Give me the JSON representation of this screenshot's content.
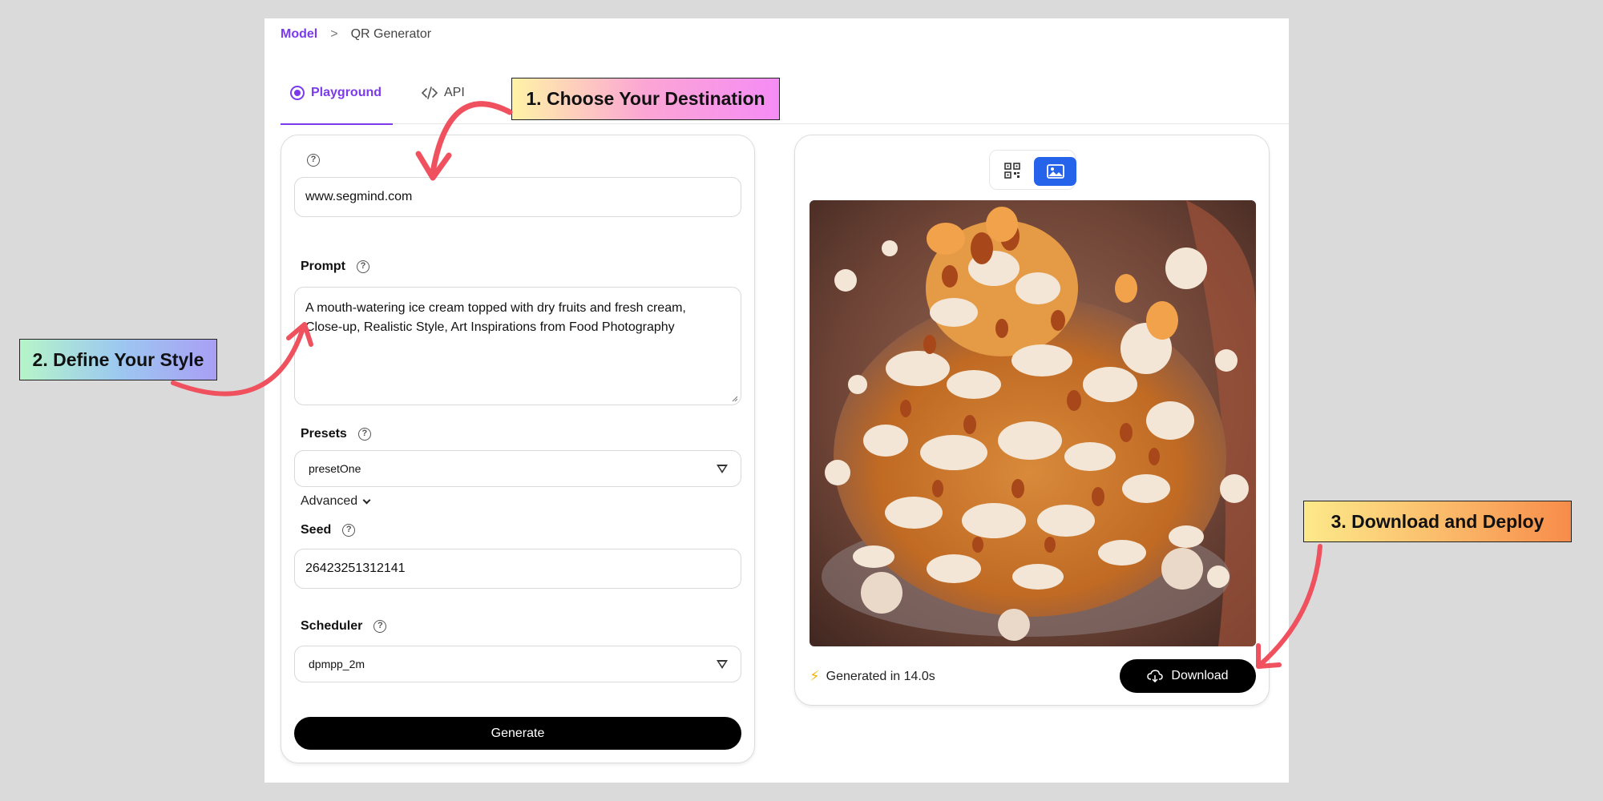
{
  "breadcrumb": {
    "root": "Model",
    "separator": ">",
    "current": "QR Generator"
  },
  "tabs": {
    "playground": "Playground",
    "api": "API"
  },
  "form": {
    "url_help": "?",
    "url_value": "www.segmind.com",
    "prompt_label": "Prompt",
    "prompt_value": "A mouth-watering ice cream topped with dry fruits and fresh cream,\nClose-up, Realistic Style, Art Inspirations from Food Photography",
    "presets_label": "Presets",
    "presets_value": "presetOne",
    "advanced_label": "Advanced",
    "seed_label": "Seed",
    "seed_value": "26423251312141",
    "scheduler_label": "Scheduler",
    "scheduler_value": "dpmpp_2m",
    "generate_label": "Generate"
  },
  "preview": {
    "status_text": "Generated in 14.0s",
    "download_label": "Download"
  },
  "callouts": {
    "step1": "1. Choose Your Destination",
    "step2": "2. Define Your Style",
    "step3": "3. Download and Deploy"
  },
  "colors": {
    "accent": "#7c3aed",
    "toggle_active": "#2563eb",
    "arrow": "#f0515f"
  }
}
